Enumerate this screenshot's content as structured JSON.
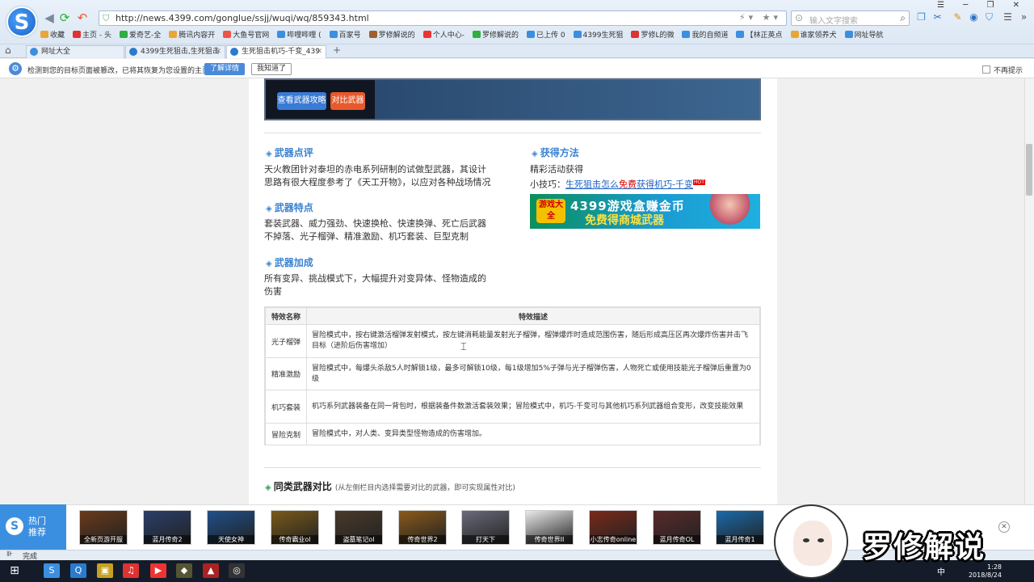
{
  "browser": {
    "url": "http://news.4399.com/gonglue/ssjj/wuqi/wq/859343.html",
    "search_placeholder": "输入文字搜索",
    "window_controls": "☰ ─ ❐ ✕",
    "favorites": [
      {
        "label": "收藏",
        "color": "#e8a63a"
      },
      {
        "label": "主页 - 头",
        "color": "#d33"
      },
      {
        "label": "爱奇艺-全",
        "color": "#2eaf3e"
      },
      {
        "label": "腾讯内容开",
        "color": "#e8a63a"
      },
      {
        "label": "大鱼号官网",
        "color": "#e54"
      },
      {
        "label": "哔哩哔哩 (",
        "color": "#3b8fe0"
      },
      {
        "label": "百家号",
        "color": "#3b8fe0"
      },
      {
        "label": "罗修解说的",
        "color": "#a06030"
      },
      {
        "label": "个人中心-",
        "color": "#e33"
      },
      {
        "label": "罗修解说的",
        "color": "#2eaf3e"
      },
      {
        "label": "已上传 0",
        "color": "#3b8fe0"
      },
      {
        "label": "4399生死狙",
        "color": "#3b8fe0"
      },
      {
        "label": "罗修L的微",
        "color": "#d33"
      },
      {
        "label": "我的自频道",
        "color": "#3b8fe0"
      },
      {
        "label": "【林正英点",
        "color": "#3b8fe0"
      },
      {
        "label": "谁家领养犬",
        "color": "#e8a63a"
      },
      {
        "label": "网址导航",
        "color": "#3b8fe0"
      }
    ],
    "tabs": [
      {
        "label": "网址大全"
      },
      {
        "label": "4399生死狙击,生死狙击"
      },
      {
        "label": "生死狙击机巧-千变_439"
      }
    ],
    "notice": {
      "message": "检测到您的目标页面被篡改，已将其恢复为您设置的主页。",
      "detail_button": "了解详情",
      "known_button": "我知道了",
      "no_show": "不再提示"
    },
    "status_text": "完成"
  },
  "page": {
    "btn_guide": "查看武器攻略",
    "btn_compare": "对比武器",
    "review": {
      "title": "武器点评",
      "text": "天火教团针对泰坦的赤电系列研制的试做型武器，其设计思路有很大程度参考了《天工开物》，以应对各种战场情况"
    },
    "features": {
      "title": "武器特点",
      "text": "套装武器、威力强劲、快速换枪、快速换弹、死亡后武器不掉落、光子榴弹、精准激励、机巧套装、巨型克制"
    },
    "bonus": {
      "title": "武器加成",
      "text": "所有变异、挑战模式下，大幅提升对变异体、怪物造成的伤害"
    },
    "obtain": {
      "title": "获得方法",
      "text": "精彩活动获得",
      "tip_label": "小技巧：",
      "tip_link_a": "生死狙击怎么",
      "tip_link_b": "免费",
      "tip_link_c": "获得机巧-千变",
      "hot": "HOT"
    },
    "ad": {
      "badge": "游戏大全",
      "line1": "4399游戏盒赚金币",
      "line2": "免费得商城武器"
    },
    "table": {
      "headers": [
        "特效名称",
        "特效描述"
      ],
      "rows": [
        {
          "name": "光子榴弹",
          "desc": "冒险模式中，按右键激活榴弹发射模式，按左键消耗能量发射光子榴弹，榴弹爆炸时造成范围伤害，随后形成高压区再次爆炸伤害并击飞目标（进阶后伤害增加）"
        },
        {
          "name": "精准激励",
          "desc": "冒险模式中，每爆头杀敌5人时解锁1级，最多可解锁10级，每1级增加5%子弹与光子榴弹伤害，人物死亡或使用技能光子榴弹后重置为0级"
        },
        {
          "name": "机巧套装",
          "desc": "机巧系列武器装备在同一背包时，根据装备件数激活套装效果；冒险模式中，机巧-千变可与其他机巧系列武器组合变形，改变技能效果"
        },
        {
          "name": "冒险克制",
          "desc": "冒险模式中，对人类、变异类型怪物造成的伤害增加。"
        }
      ]
    },
    "compare": {
      "title": "同类武器对比",
      "subtitle": "(从左侧栏目内选择需要对比的武器，即可实现属性对比)"
    }
  },
  "hot": {
    "label_line1": "热门",
    "label_line2": "推荐",
    "games": [
      {
        "name": "全新页游开服",
        "color": "#6a3a1a"
      },
      {
        "name": "蓝月传奇2",
        "color": "#2a3f6a"
      },
      {
        "name": "天使女神",
        "color": "#1f4f8a"
      },
      {
        "name": "传奇霸业ol",
        "color": "#7a5a1a"
      },
      {
        "name": "盗墓笔记ol",
        "color": "#4a3a2a"
      },
      {
        "name": "传奇世界2",
        "color": "#8a5a1a"
      },
      {
        "name": "打天下",
        "color": "#6a6a7a"
      },
      {
        "name": "传奇世界II",
        "color": "#eaeaea"
      },
      {
        "name": "小志传奇online",
        "color": "#7a2a1a"
      },
      {
        "name": "蓝月传奇OL",
        "color": "#5a2a2a"
      },
      {
        "name": "蓝月传奇1",
        "color": "#1a6aaa"
      }
    ]
  },
  "taskbar": {
    "time": "1:28",
    "date": "2018/8/24",
    "ime": "中"
  },
  "watermark": {
    "text": "罗修解说"
  }
}
